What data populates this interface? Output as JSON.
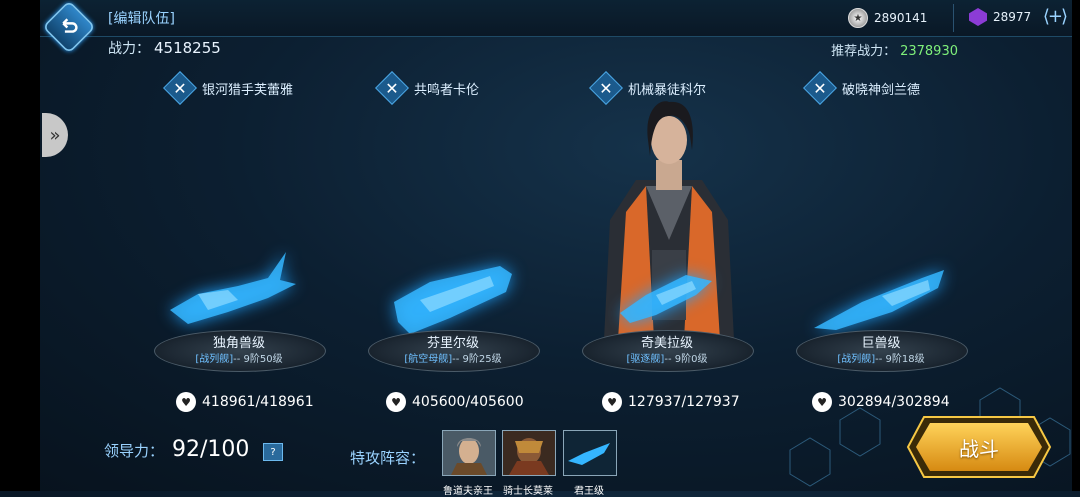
{
  "header": {
    "title": "[编辑队伍]",
    "power_label": "战力：",
    "power_value": "4518255",
    "recommended_label": "推荐战力：",
    "recommended_value": "2378930",
    "gold": "2890141",
    "gems": "28977",
    "plus": "⟨+⟩"
  },
  "slots": [
    {
      "name": "银河猎手芙蕾雅",
      "ship": "独角兽级",
      "class": "[战列舰]",
      "rank": "-- 9阶50级",
      "hp": "418961/418961"
    },
    {
      "name": "共鸣者卡伦",
      "ship": "芬里尔级",
      "class": "[航空母舰]",
      "rank": "-- 9阶25级",
      "hp": "405600/405600"
    },
    {
      "name": "机械暴徒科尔",
      "ship": "奇美拉级",
      "class": "[驱逐舰]",
      "rank": "-- 9阶0级",
      "hp": "127937/127937"
    },
    {
      "name": "破晓神剑兰德",
      "ship": "巨兽级",
      "class": "[战列舰]",
      "rank": "-- 9阶18级",
      "hp": "302894/302894"
    }
  ],
  "footer": {
    "leadership_label": "领导力：",
    "leadership_value": "92/100",
    "help": "?",
    "special_label": "特攻阵容：",
    "specials": [
      {
        "name": "鲁道夫亲王"
      },
      {
        "name": "骑士长莫莱"
      },
      {
        "name": "君王级"
      }
    ],
    "battle": "战斗"
  },
  "colors": {
    "accent": "#9ad3ff",
    "recommended": "#7ff07a",
    "ship_glow": "#1ea3ff",
    "battle": "#f0b020"
  }
}
